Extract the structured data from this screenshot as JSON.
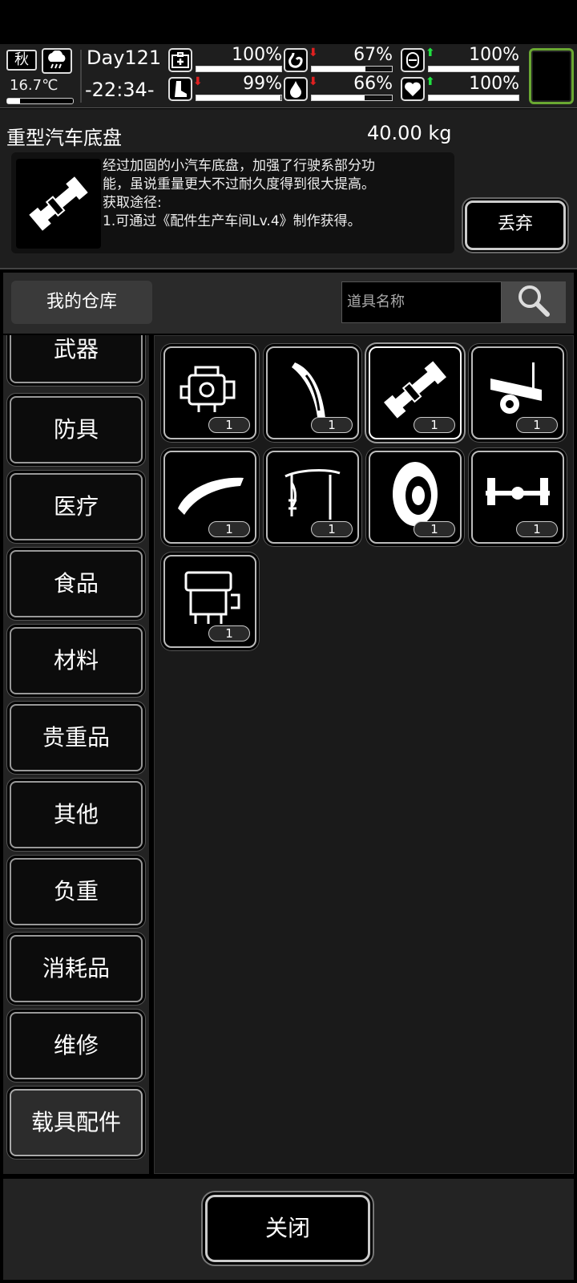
{
  "status": {
    "season": "秋",
    "day": "Day121",
    "time": "-22:34-",
    "temperature": "16.7℃",
    "temperature_level": 0.2,
    "stats": [
      {
        "icon": "medkit-icon",
        "value": "100%",
        "fill": 1.0,
        "trend": ""
      },
      {
        "icon": "stomach-icon",
        "value": "67%",
        "fill": 0.67,
        "trend": "down"
      },
      {
        "icon": "stamina-icon",
        "value": "100%",
        "fill": 1.0,
        "trend": "up"
      },
      {
        "icon": "boot-icon",
        "value": "99%",
        "fill": 0.99,
        "trend": "down"
      },
      {
        "icon": "water-drop-icon",
        "value": "66%",
        "fill": 0.66,
        "trend": "down"
      },
      {
        "icon": "heart-icon",
        "value": "100%",
        "fill": 1.0,
        "trend": "up"
      }
    ],
    "colors": {
      "up": "#20e040",
      "down": "#e02020",
      "portrait_border": "#6aa832"
    }
  },
  "detail": {
    "name": "重型汽车底盘",
    "weight": "40.00 kg",
    "description": "经过加固的小汽车底盘，加强了行驶系部分功\n能，虽说重量更大不过耐久度得到很大提高。\n获取途径:\n1.可通过《配件生产车间Lv.4》制作获得。",
    "drop_label": "丢弃"
  },
  "warehouse": {
    "tab_label": "我的仓库",
    "search_placeholder": "道具名称"
  },
  "categories": [
    {
      "label": "武器"
    },
    {
      "label": "防具"
    },
    {
      "label": "医疗"
    },
    {
      "label": "食品"
    },
    {
      "label": "材料"
    },
    {
      "label": "贵重品"
    },
    {
      "label": "其他"
    },
    {
      "label": "负重"
    },
    {
      "label": "消耗品"
    },
    {
      "label": "维修"
    },
    {
      "label": "载具配件",
      "active": true
    }
  ],
  "items": [
    {
      "icon": "engine-icon",
      "qty": "1"
    },
    {
      "icon": "fender-icon",
      "qty": "1"
    },
    {
      "icon": "chassis-icon",
      "qty": "1",
      "selected": true
    },
    {
      "icon": "trailer-icon",
      "qty": "1"
    },
    {
      "icon": "spoiler-icon",
      "qty": "1"
    },
    {
      "icon": "hood-icon",
      "qty": "1"
    },
    {
      "icon": "tire-icon",
      "qty": "1"
    },
    {
      "icon": "axle-icon",
      "qty": "1"
    },
    {
      "icon": "engine-block-icon",
      "qty": "1"
    }
  ],
  "footer": {
    "close_label": "关闭"
  }
}
